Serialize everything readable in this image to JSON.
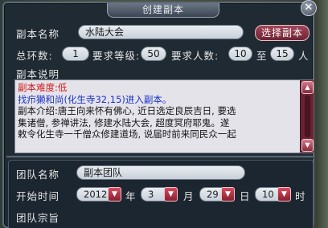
{
  "window": {
    "title": "创建副本",
    "close_glyph": "✕"
  },
  "instance": {
    "name_label": "副本名称",
    "name_value": "水陆大会",
    "pick_button": "选择副本",
    "rings_label": "总环数:",
    "rings_value": "1",
    "level_label": "要求等级:",
    "level_value": "50",
    "people_label": "要求人数:",
    "people_min": "10",
    "people_to": "至",
    "people_max": "15",
    "people_unit": "人"
  },
  "description": {
    "label": "副本说明",
    "lines": [
      {
        "text": "副本难度:低",
        "color": "red"
      },
      {
        "text": "找疖獭和尚(化生寺32,15)进入副本。",
        "color": "blue"
      },
      {
        "text": "副本介绍:唐王向来怀有佛心, 近日选定良辰吉日, 要选",
        "color": "black"
      },
      {
        "text": "集诸僧, 参禅讲法, 修建水陆大会, 超度冥府耶鬼。遂",
        "color": "black"
      },
      {
        "text": "敕令化生寺一千僧众修建道场, 说届时前来同民众一起",
        "color": "black"
      }
    ]
  },
  "team": {
    "name_label": "团队名称",
    "name_value": "副本团队",
    "start_label": "开始时间",
    "year_value": "2012",
    "year_unit": "年",
    "month_value": "3",
    "month_unit": "月",
    "day_value": "29",
    "day_unit": "日",
    "hour_value": "10",
    "hour_unit": "时",
    "purpose_label": "团队宗旨"
  },
  "icons": {
    "close": "close-icon",
    "scroll_up": "triangle-up-icon",
    "scroll_down": "triangle-down-icon",
    "dropdown": "chevron-down-icon"
  },
  "colors": {
    "accent_button": "#8b2a3d",
    "window_bg": "#1f2a33",
    "difficulty": "#d11818",
    "npc_link": "#1932c8"
  }
}
